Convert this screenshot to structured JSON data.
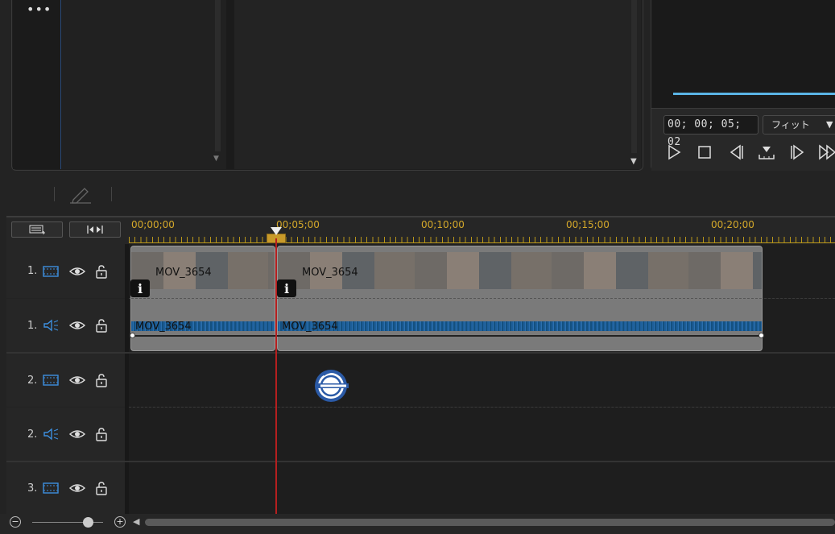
{
  "library": {
    "more_label": "•••"
  },
  "preview": {
    "timecode": "00; 00; 05; 02",
    "fit_label": "フィット",
    "progress": 1.0
  },
  "timeline": {
    "ruler_labels": [
      "00;00;00",
      "00;05;00",
      "00;10;00",
      "00;15;00",
      "00;20;00"
    ],
    "tracks": [
      {
        "num": "1.",
        "type": "video"
      },
      {
        "num": "1.",
        "type": "audio"
      },
      {
        "num": "2.",
        "type": "video"
      },
      {
        "num": "2.",
        "type": "audio"
      },
      {
        "num": "3.",
        "type": "video"
      }
    ],
    "clips": {
      "video_a": "MOV_3654",
      "video_b": "MOV_3654",
      "audio_a": "MOV_3654",
      "audio_b": "MOV_3654",
      "info_glyph": "i"
    }
  },
  "colors": {
    "accent_blue": "#5ab4e6",
    "playhead": "#b51f1f",
    "ruler": "#d4a82a"
  }
}
